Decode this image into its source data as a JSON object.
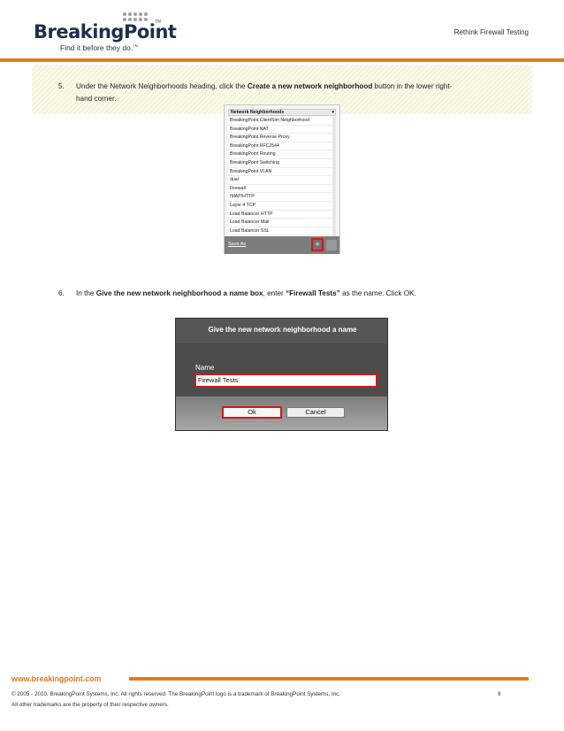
{
  "header": {
    "logo_part1": "Breaking",
    "logo_part2": "Point",
    "logo_tm": "TM",
    "tagline": "Find it before they do.",
    "tagline_tm": "TM",
    "doc_title": "Rethink Firewall Testing"
  },
  "steps": [
    {
      "number": "5.",
      "text_before": "Under the Network Neighborhoods heading, click the ",
      "bold": "Create a new network neighborhood",
      "text_after": " button in the lower right-",
      "line2": "hand corner."
    },
    {
      "number": "6.",
      "text_before": "In the ",
      "bold": "Give the new network neighborhood a name box",
      "text_mid": ", enter ",
      "bold2": "“Firewall Tests”",
      "text_after": " as the name. Click OK."
    }
  ],
  "screenshot1": {
    "header": "Network Neighborhoods",
    "items": [
      "BreakingPoint ClientSim Neighborhood",
      "BreakingPoint NAT",
      "BreakingPoint Reverse Proxy",
      "BreakingPoint RFC2544",
      "BreakingPoint Routing",
      "BreakingPoint Switching",
      "BreakingPoint VLAN",
      "dual",
      "Firewall",
      "IMAP/HTTP",
      "Layer 4 TCP",
      "Load Balancer HTTP",
      "Load Balancer Mail",
      "Load Balancer SSL"
    ],
    "save_as": "Save As",
    "plus": "+"
  },
  "screenshot2": {
    "title": "Give the new network neighborhood a name",
    "name_label": "Name",
    "name_value": "Firewall Tests",
    "ok": "Ok",
    "cancel": "Cancel"
  },
  "footer": {
    "url": "www.breakingpoint.com",
    "copyright": "© 2005 - 2010. BreakingPoint Systems, Inc. All rights reserved. The BreakingPoint logo is a trademark of BreakingPoint Systems, Inc.",
    "trademarks": "All other trademarks are the property of their respective owners.",
    "page": "9"
  },
  "colors": {
    "accent": "#e07c1e",
    "logo_navy": "#1d2f4f",
    "highlight_red": "#d01a1a"
  }
}
